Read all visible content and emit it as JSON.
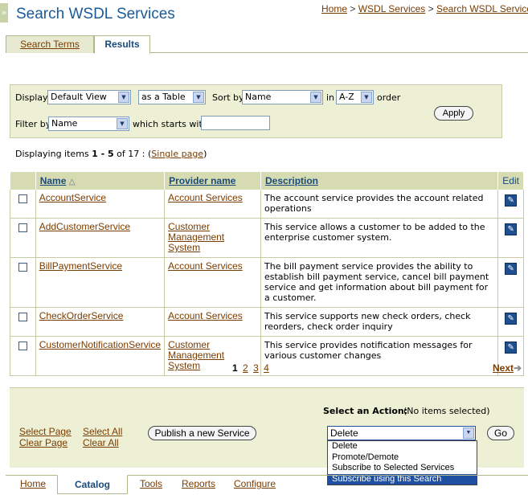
{
  "side_toggle": "»",
  "page_title": "Search WSDL Services",
  "breadcrumb": [
    "Home",
    "WSDL Services",
    "Search WSDL Services"
  ],
  "breadcrumb_sep": ">",
  "top_tabs": [
    "Search Terms",
    "Results"
  ],
  "filter": {
    "display_label": "Display",
    "display_value": "Default View",
    "as_value": "as a Table",
    "sort_label": "Sort by",
    "sort_value": "Name",
    "in_label": "in",
    "order_value": "A-Z",
    "order_label": "order",
    "filter_label": "Filter by",
    "filter_value": "Name",
    "starts_label": "which starts with",
    "starts_value": "",
    "apply_label": "Apply"
  },
  "displaying": {
    "prefix": "Displaying items ",
    "range": "1 - 5",
    "mid": " of 17 : (",
    "single_page": "Single page",
    "suffix": ")"
  },
  "table": {
    "headers": [
      "Name",
      "Provider name",
      "Description",
      "Edit"
    ],
    "rows": [
      {
        "name": "AccountService",
        "provider": "Account Services",
        "description": "The account service provides the account related operations"
      },
      {
        "name": "AddCustomerService",
        "provider": "Customer Management System",
        "description": "This service allows a customer to be added to the enterprise customer system."
      },
      {
        "name": "BillPaymentService",
        "provider": "Account Services",
        "description": "The bill payment service provides the ability to establish bill payment service, cancel bill payment service and get information about bill payment for a customer."
      },
      {
        "name": "CheckOrderService",
        "provider": "Account Services",
        "description": "This service supports new check orders, check reorders, check order inquiry"
      },
      {
        "name": "CustomerNotificationService",
        "provider": "Customer Management System",
        "description": "This service provides notification messages for various customer changes"
      }
    ]
  },
  "pager": {
    "current": "1",
    "pages": [
      "2",
      "3",
      "4"
    ],
    "next": "Next"
  },
  "actions": {
    "select_action_label": "Select an Action:",
    "no_items": "(No items selected)",
    "select_page": "Select Page",
    "clear_page": "Clear Page",
    "select_all": "Select All",
    "clear_all": "Clear All",
    "publish": "Publish a new Service",
    "action_value": "Delete",
    "go": "Go",
    "options": [
      "Delete",
      "Promote/Demote",
      "Subscribe to Selected Services",
      "Subscribe using this Search"
    ],
    "highlighted_option": "Subscribe using this Search"
  },
  "bottom_tabs": [
    "Home",
    "Catalog",
    "Tools",
    "Reports",
    "Configure"
  ],
  "colors": {
    "accent": "#1a5a9a",
    "link": "#7a3c00",
    "panel": "#eef0d6",
    "header": "#d6dbb2",
    "highlight": "#1e4fa0"
  }
}
